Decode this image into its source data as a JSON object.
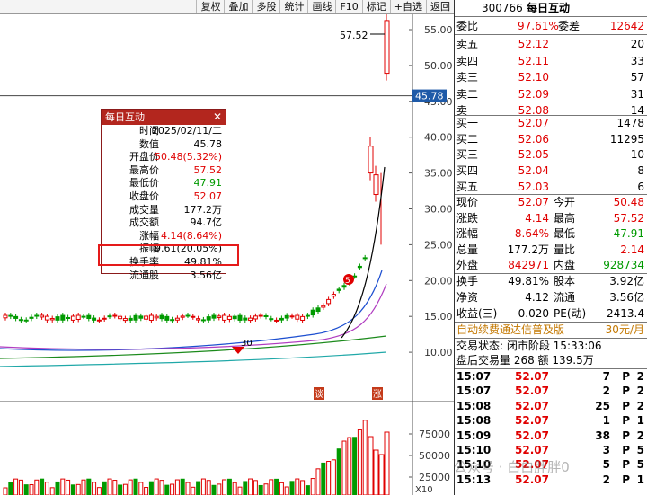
{
  "toolbar": {
    "buttons": [
      "复权",
      "叠加",
      "多股",
      "统计",
      "画线",
      "F10",
      "标记",
      "+自选",
      "返回"
    ]
  },
  "chart": {
    "y_ticks": [
      "55.00",
      "50.00",
      "45.00",
      "40.00",
      "35.00",
      "30.00",
      "25.00",
      "20.00",
      "15.00",
      "10.00"
    ],
    "crosshair_value": "45.78",
    "high_label": "57.52",
    "low_label": "30",
    "marker_5": "5",
    "marker_tan": "谈",
    "marker_zhang": "涨",
    "vol_ticks": [
      "75000",
      "50000",
      "25000"
    ],
    "vol_unit": "X10"
  },
  "popup": {
    "title": "每日互动",
    "rows": [
      {
        "label": "时间",
        "value": "2025/02/11/二",
        "color": "#000"
      },
      {
        "label": "数值",
        "value": "45.78",
        "color": "#000"
      },
      {
        "label": "开盘价",
        "value": "50.48(5.32%)",
        "color": "#e00000"
      },
      {
        "label": "最高价",
        "value": "57.52",
        "color": "#e00000"
      },
      {
        "label": "最低价",
        "value": "47.91",
        "color": "#009a00"
      },
      {
        "label": "收盘价",
        "value": "52.07",
        "color": "#e00000"
      },
      {
        "label": "成交量",
        "value": "177.2万",
        "color": "#000"
      },
      {
        "label": "成交额",
        "value": "94.7亿",
        "color": "#000"
      },
      {
        "label": "涨幅",
        "value": "4.14(8.64%)",
        "color": "#e00000"
      },
      {
        "label": "振幅",
        "value": "9.61(20.05%)",
        "color": "#000"
      },
      {
        "label": "换手率",
        "value": "49.81%",
        "color": "#000"
      },
      {
        "label": "流通股",
        "value": "3.56亿",
        "color": "#000"
      }
    ]
  },
  "panel": {
    "code": "300766",
    "name": "每日互动",
    "weibi_label": "委比",
    "weibi": "97.61%",
    "weicha_label": "委差",
    "weicha": "12642",
    "asks": [
      {
        "label": "卖五",
        "price": "52.12",
        "vol": "20"
      },
      {
        "label": "卖四",
        "price": "52.11",
        "vol": "33"
      },
      {
        "label": "卖三",
        "price": "52.10",
        "vol": "57"
      },
      {
        "label": "卖二",
        "price": "52.09",
        "vol": "31"
      },
      {
        "label": "卖一",
        "price": "52.08",
        "vol": "14"
      }
    ],
    "bids": [
      {
        "label": "买一",
        "price": "52.07",
        "vol": "1478"
      },
      {
        "label": "买二",
        "price": "52.06",
        "vol": "11295"
      },
      {
        "label": "买三",
        "price": "52.05",
        "vol": "10"
      },
      {
        "label": "买四",
        "price": "52.04",
        "vol": "8"
      },
      {
        "label": "买五",
        "price": "52.03",
        "vol": "6"
      }
    ],
    "stats": [
      {
        "l1": "现价",
        "v1": "52.07",
        "c1": "#e00000",
        "l2": "今开",
        "v2": "50.48",
        "c2": "#e00000"
      },
      {
        "l1": "涨跌",
        "v1": "4.14",
        "c1": "#e00000",
        "l2": "最高",
        "v2": "57.52",
        "c2": "#e00000"
      },
      {
        "l1": "涨幅",
        "v1": "8.64%",
        "c1": "#e00000",
        "l2": "最低",
        "v2": "47.91",
        "c2": "#009a00"
      },
      {
        "l1": "总量",
        "v1": "177.2万",
        "c1": "#000",
        "l2": "量比",
        "v2": "2.14",
        "c2": "#e00000"
      },
      {
        "l1": "外盘",
        "v1": "842971",
        "c1": "#e00000",
        "l2": "内盘",
        "v2": "928734",
        "c2": "#009a00"
      }
    ],
    "stats2": [
      {
        "l1": "换手",
        "v1": "49.81%",
        "l2": "股本",
        "v2": "3.92亿"
      },
      {
        "l1": "净资",
        "v1": "4.12",
        "l2": "流通",
        "v2": "3.56亿"
      },
      {
        "l1": "收益(三)",
        "v1": "0.020",
        "l2": "PE(动)",
        "v2": "2413.4"
      }
    ],
    "promo": "自动续费通达信普及版",
    "promo_price": "30元/月",
    "trade_state": "交易状态: 闭市阶段 15:33:06",
    "after_hours": "盘后交易量 268 额 139.5万",
    "ticks": [
      {
        "time": "15:07",
        "price": "52.07",
        "vol": "7",
        "flag": "P",
        "n": "2"
      },
      {
        "time": "15:07",
        "price": "52.07",
        "vol": "2",
        "flag": "P",
        "n": "2"
      },
      {
        "time": "15:08",
        "price": "52.07",
        "vol": "25",
        "flag": "P",
        "n": "2"
      },
      {
        "time": "15:08",
        "price": "52.07",
        "vol": "1",
        "flag": "P",
        "n": "1"
      },
      {
        "time": "15:09",
        "price": "52.07",
        "vol": "38",
        "flag": "P",
        "n": "2"
      },
      {
        "time": "15:10",
        "price": "52.07",
        "vol": "3",
        "flag": "P",
        "n": "5"
      },
      {
        "time": "15:10",
        "price": "52.07",
        "vol": "5",
        "flag": "P",
        "n": "5"
      },
      {
        "time": "15:13",
        "price": "52.07",
        "vol": "2",
        "flag": "P",
        "n": "1"
      }
    ]
  },
  "watermark": "公众号 · 白白胖胖0"
}
